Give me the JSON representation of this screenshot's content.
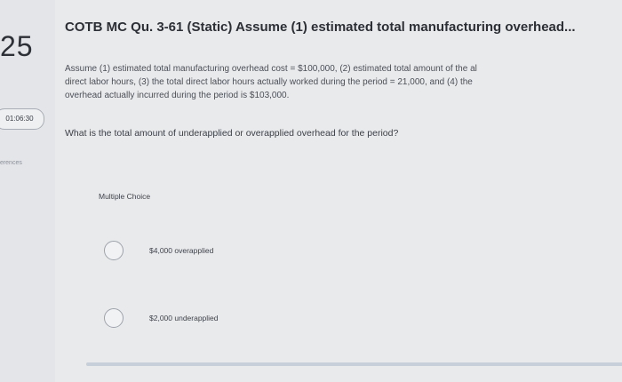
{
  "sidebar": {
    "question_number": "25",
    "timer": "01:06:30",
    "references_label": "ferences"
  },
  "question": {
    "title": "COTB MC Qu. 3-61 (Static) Assume (1) estimated total manufacturing overhead...",
    "body_lines": [
      "Assume (1) estimated total manufacturing overhead cost = $100,000, (2) estimated total amount of the al",
      "direct labor hours, (3) the total direct labor hours actually worked during the period = 21,000, and (4) the",
      "overhead actually incurred during the period is $103,000."
    ],
    "prompt": "What is the total amount of underapplied or overapplied overhead for the period?"
  },
  "multiple_choice": {
    "heading": "Multiple Choice",
    "options": [
      {
        "label": "$4,000 overapplied"
      },
      {
        "label": "$2,000 underapplied"
      }
    ]
  }
}
